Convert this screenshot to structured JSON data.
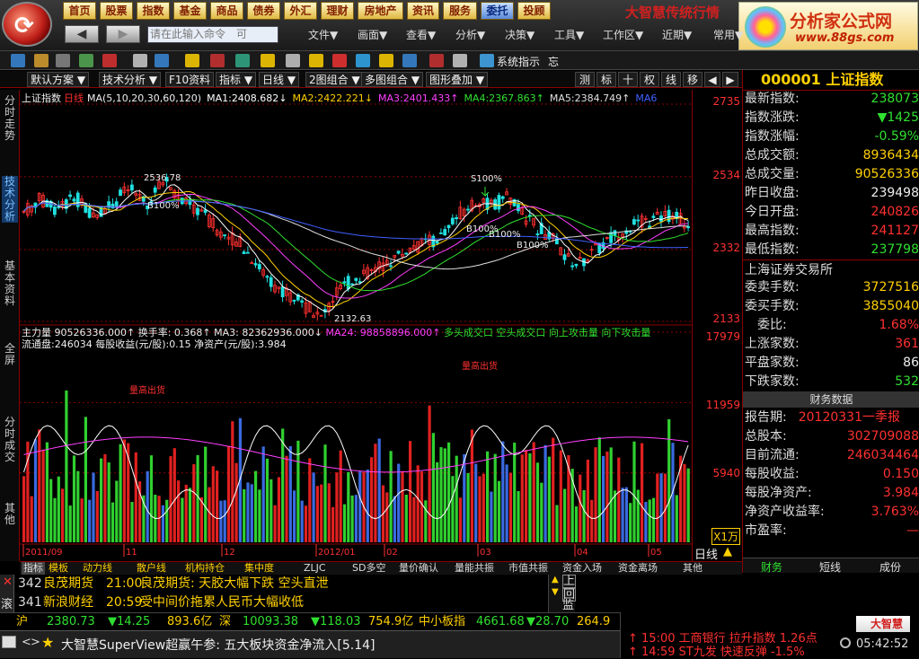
{
  "topnav": [
    "首页",
    "股票",
    "指数",
    "基金",
    "商品",
    "债券",
    "外汇",
    "理财",
    "房地产",
    "资讯",
    "服务",
    "委托",
    "投顾"
  ],
  "brand_text": "大智慧传统行情",
  "brand": {
    "name": "分析家公式网",
    "url": "www.88gs.com"
  },
  "command_placeholder": "请在此输入命令　可",
  "menus": [
    "文件▼",
    "画面▼",
    "查看▼",
    "分析▼",
    "决策▼",
    "工具▼",
    "工作区▼",
    "近期▼",
    "常用▼"
  ],
  "toolbar_text": {
    "system": "系统指示",
    "more": "忘"
  },
  "tabs2": [
    "默认方案 ▼",
    "技术分析 ▼",
    "F10资料",
    "指标 ▼",
    "日线 ▼",
    "2图组合 ▼",
    "多图组合 ▼",
    "图形叠加 ▼"
  ],
  "tabs2_right": [
    "测",
    "标",
    "十",
    "权",
    "线",
    "移"
  ],
  "left_tabs": [
    "分时走势",
    "技术分析",
    "基本资料",
    "全屏",
    "分时成交",
    "其他"
  ],
  "chart_header": {
    "title": "上证指数",
    "period": "日线",
    "ma_params": "MA(5,10,20,30,60,120)",
    "ma": [
      {
        "label": "MA1:",
        "value": "2408.682",
        "arrow": "↓",
        "color": "#ffffff"
      },
      {
        "label": "MA2:",
        "value": "2422.221",
        "arrow": "↓",
        "color": "#ffd000"
      },
      {
        "label": "MA3:",
        "value": "2401.433",
        "arrow": "↑",
        "color": "#ff40ff"
      },
      {
        "label": "MA4:",
        "value": "2367.863",
        "arrow": "↑",
        "color": "#30e030"
      },
      {
        "label": "MA5:",
        "value": "2384.749",
        "arrow": "↑",
        "color": "#e0e0e0"
      },
      {
        "label": "MA6",
        "value": "",
        "arrow": "",
        "color": "#4060ff"
      }
    ]
  },
  "vol_header": {
    "line1": "主力量  90526336.000↑ 换手率: 0.368↑ MA3: 82362936.000↓ ",
    "ma24": "MA24: 98858896.000↑",
    "signals": "多头成交口  空头成交口  向上攻击量  向下攻击量",
    "line2": "流通盘:246034 每股收益(元/股):0.15 净资产(元/股):3.984"
  },
  "annotations": {
    "high": "2536.78",
    "low": "2132.63",
    "b1": "B100%",
    "b2": "B100%",
    "b3": "B100%",
    "b4": "B100%",
    "s1": "S100%",
    "vol1": "量高出货",
    "vol2": "量高出货"
  },
  "price_axis": [
    "2735",
    "2534",
    "2332",
    "2133"
  ],
  "vol_axis": [
    "17979",
    "11959",
    "5940",
    "X1万"
  ],
  "date_axis": [
    "2011/09",
    "11",
    "12",
    "2012/01",
    "02",
    "03",
    "04",
    "05"
  ],
  "period_label": "日线",
  "chart_data": {
    "type": "candlestick",
    "title": "上证指数",
    "period": "日线",
    "price_range": [
      2133,
      2735
    ],
    "volume_range": [
      0,
      17979
    ],
    "volume_unit": "万",
    "high": 2536.78,
    "low": 2132.63,
    "x_ticks": [
      "2011/09",
      "11",
      "12",
      "2012/01",
      "02",
      "03",
      "04",
      "05"
    ],
    "moving_averages": [
      {
        "name": "MA1",
        "value": 2408.682
      },
      {
        "name": "MA2",
        "value": 2422.221
      },
      {
        "name": "MA3",
        "value": 2401.433
      },
      {
        "name": "MA4",
        "value": 2367.863
      },
      {
        "name": "MA5",
        "value": 2384.749
      }
    ]
  },
  "right_panel": {
    "title": "000001 上证指数",
    "rows1": [
      {
        "k": "最新指数:",
        "v": "238073",
        "c": "#30e030"
      },
      {
        "k": "指数涨跌:",
        "v": "▼1425",
        "c": "#30e030"
      },
      {
        "k": "指数涨幅:",
        "v": "-0.59%",
        "c": "#30e030"
      },
      {
        "k": "总成交额:",
        "v": "8936434",
        "c": "#ffd000"
      },
      {
        "k": "总成交量:",
        "v": "90526336",
        "c": "#ffd000"
      },
      {
        "k": "昨日收盘:",
        "v": "239498",
        "c": "#eee"
      },
      {
        "k": "今日开盘:",
        "v": "240826",
        "c": "#ff3030"
      },
      {
        "k": "最高指数:",
        "v": "241127",
        "c": "#ff3030"
      },
      {
        "k": "最低指数:",
        "v": "237798",
        "c": "#30e030"
      }
    ],
    "exchange": "上海证券交易所",
    "rows2": [
      {
        "k": "委卖手数:",
        "v": "3727516",
        "c": "#ffd000"
      },
      {
        "k": "委买手数:",
        "v": "3855040",
        "c": "#ffd000"
      },
      {
        "k": "　委比:",
        "v": "1.68%",
        "c": "#ff3030"
      },
      {
        "k": "上涨家数:",
        "v": "361",
        "c": "#ff3030"
      },
      {
        "k": "平盘家数:",
        "v": "86",
        "c": "#eee"
      },
      {
        "k": "下跌家数:",
        "v": "532",
        "c": "#30e030"
      }
    ],
    "fin_head": "财务数据",
    "rows3": [
      {
        "k": "报告期:",
        "v": "20120331一季报",
        "c": "#ff3030",
        "left": true
      },
      {
        "k": "总股本:",
        "v": "302709088",
        "c": "#ff3030"
      },
      {
        "k": "目前流通:",
        "v": "246034464",
        "c": "#ff3030"
      },
      {
        "k": "每股收益:",
        "v": "0.150",
        "c": "#ff3030"
      },
      {
        "k": "每股净资产:",
        "v": "3.984",
        "c": "#ff3030"
      },
      {
        "k": "净资产收益率:",
        "v": "3.763%",
        "c": "#ff3030"
      },
      {
        "k": "市盈率:",
        "v": "—",
        "c": "#ff3030"
      }
    ],
    "bottom_tabs": [
      "财务",
      "短线",
      "成份"
    ]
  },
  "bottom_tabs": [
    "指标",
    "模板",
    "动力线",
    "散户线",
    "机构持仓",
    "集中度",
    "ZLJC",
    "SD多空",
    "量价确认",
    "量能共振",
    "市值共振",
    "资金入场",
    "资金离场",
    "其他"
  ],
  "news": [
    {
      "no": "342",
      "src": "良茂期货",
      "time": "21:00",
      "text": "良茂期货: 天胶大幅下跌 空头直泄"
    },
    {
      "no": "341",
      "src": "新浪财经",
      "time": "20:59",
      "text": "受中间价拖累人民币大幅收低"
    }
  ],
  "news_side": {
    "top": "上",
    "mid": "回",
    "bot": "监",
    "left1": "滚"
  },
  "ticker": {
    "sh_label": "沪",
    "sh": "2380.73",
    "sh_chg": "▼14.25",
    "sh_amt": "893.6亿",
    "sz_label": "深",
    "sz": "10093.38",
    "sz_chg": "▼118.03",
    "sz_amt": "754.9亿",
    "zx_label": "中小板指",
    "zx": "4661.68",
    "zx_chg": "▼28.70",
    "zx_amt": "264.9亿"
  },
  "status": {
    "text": "大智慧SuperView超赢午参: 五大板块资金净流入[5.14]"
  },
  "alerts": [
    {
      "time": "15:00",
      "text": "工商银行 拉升指数 1.26点"
    },
    {
      "time": "14:59",
      "text": "ST九发  快速反弹 -1.5%"
    }
  ],
  "clock": "05:42:52",
  "dzh_logo": "大智慧"
}
